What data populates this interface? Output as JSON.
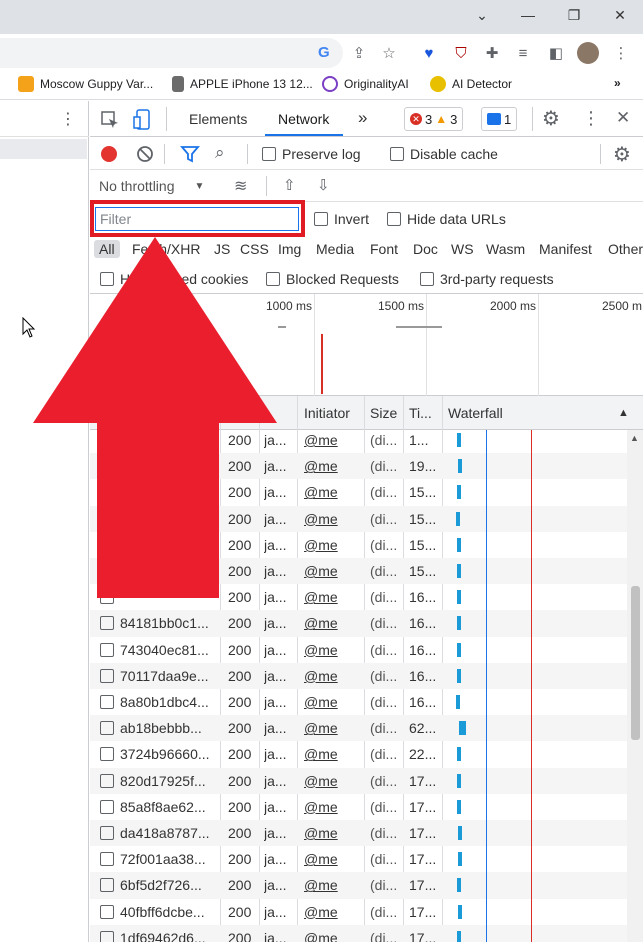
{
  "bookmarks": [
    {
      "label": "Moscow Guppy Var...",
      "color": "#f4a21a"
    },
    {
      "label": "APPLE iPhone 13 12...",
      "color": "#6b6b6b"
    },
    {
      "label": "OriginalityAI",
      "color": "#7b3fc4"
    },
    {
      "label": "AI Detector",
      "color": "#e8c000"
    }
  ],
  "devtools": {
    "tabs": {
      "elements": "Elements",
      "network": "Network"
    },
    "errors": "3",
    "warnings": "3",
    "messages": "1",
    "preserve_log": "Preserve log",
    "disable_cache": "Disable cache",
    "throttling": "No throttling",
    "filter_placeholder": "Filter",
    "invert": "Invert",
    "hide_data_urls": "Hide data URLs",
    "types": [
      "All",
      "Fetch/XHR",
      "JS",
      "CSS",
      "Img",
      "Media",
      "Font",
      "Doc",
      "WS",
      "Wasm",
      "Manifest",
      "Other"
    ],
    "has_blocked_cookies": "Has blocked cookies",
    "blocked_requests": "Blocked Requests",
    "third_party": "3rd-party requests",
    "overview_labels": [
      "1000 ms",
      "1500 ms",
      "2000 ms",
      "2500 m"
    ],
    "columns": {
      "initiator": "Initiator",
      "size": "Size",
      "time": "Ti...",
      "waterfall": "Waterfall"
    }
  },
  "requests": [
    {
      "name": "",
      "status": "200",
      "type": "ja...",
      "initiator": "@me",
      "size": "(di...",
      "time": "1..."
    },
    {
      "name": "",
      "status": "200",
      "type": "ja...",
      "initiator": "@me",
      "size": "(di...",
      "time": "19..."
    },
    {
      "name": "",
      "status": "200",
      "type": "ja...",
      "initiator": "@me",
      "size": "(di...",
      "time": "15..."
    },
    {
      "name": "",
      "status": "200",
      "type": "ja...",
      "initiator": "@me",
      "size": "(di...",
      "time": "15..."
    },
    {
      "name": "",
      "status": "200",
      "type": "ja...",
      "initiator": "@me",
      "size": "(di...",
      "time": "15..."
    },
    {
      "name": "",
      "status": "200",
      "type": "ja...",
      "initiator": "@me",
      "size": "(di...",
      "time": "15..."
    },
    {
      "name": "",
      "status": "200",
      "type": "ja...",
      "initiator": "@me",
      "size": "(di...",
      "time": "16..."
    },
    {
      "name": "84181bb0c1...",
      "status": "200",
      "type": "ja...",
      "initiator": "@me",
      "size": "(di...",
      "time": "16..."
    },
    {
      "name": "743040ec81...",
      "status": "200",
      "type": "ja...",
      "initiator": "@me",
      "size": "(di...",
      "time": "16..."
    },
    {
      "name": "70117daa9e...",
      "status": "200",
      "type": "ja...",
      "initiator": "@me",
      "size": "(di...",
      "time": "16..."
    },
    {
      "name": "8a80b1dbc4...",
      "status": "200",
      "type": "ja...",
      "initiator": "@me",
      "size": "(di...",
      "time": "16..."
    },
    {
      "name": "ab18bebbb...",
      "status": "200",
      "type": "ja...",
      "initiator": "@me",
      "size": "(di...",
      "time": "62..."
    },
    {
      "name": "3724b96660...",
      "status": "200",
      "type": "ja...",
      "initiator": "@me",
      "size": "(di...",
      "time": "22..."
    },
    {
      "name": "820d17925f...",
      "status": "200",
      "type": "ja...",
      "initiator": "@me",
      "size": "(di...",
      "time": "17..."
    },
    {
      "name": "85a8f8ae62...",
      "status": "200",
      "type": "ja...",
      "initiator": "@me",
      "size": "(di...",
      "time": "17..."
    },
    {
      "name": "da418a8787...",
      "status": "200",
      "type": "ja...",
      "initiator": "@me",
      "size": "(di...",
      "time": "17..."
    },
    {
      "name": "72f001aa38...",
      "status": "200",
      "type": "ja...",
      "initiator": "@me",
      "size": "(di...",
      "time": "17..."
    },
    {
      "name": "6bf5d2f726...",
      "status": "200",
      "type": "ja...",
      "initiator": "@me",
      "size": "(di...",
      "time": "17..."
    },
    {
      "name": "40fbff6dcbe...",
      "status": "200",
      "type": "ja...",
      "initiator": "@me",
      "size": "(di...",
      "time": "17..."
    },
    {
      "name": "1df69462d6...",
      "status": "200",
      "type": "ja...",
      "initiator": "@me",
      "size": "(di...",
      "time": "17..."
    }
  ],
  "colors": {
    "accent": "#1a73e8",
    "highlight": "#e01b24",
    "record": "#e3342f",
    "waterfall_bar": "#1a9bd7"
  }
}
